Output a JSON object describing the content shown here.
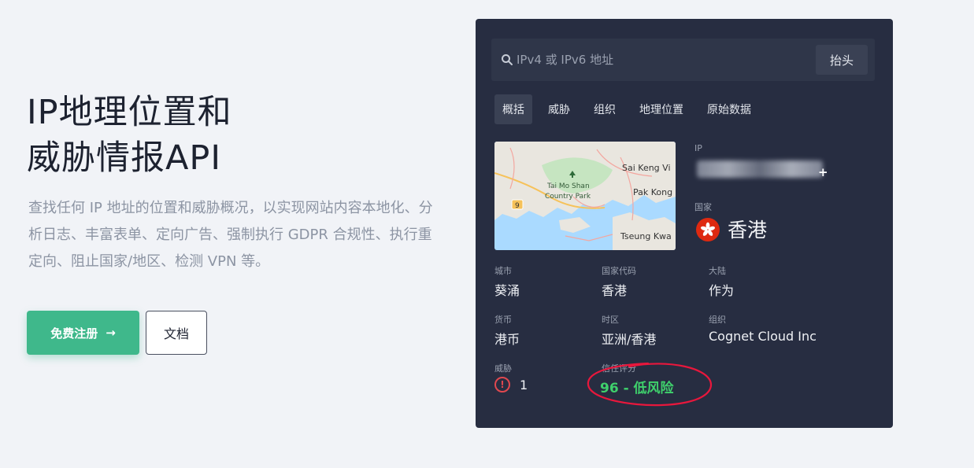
{
  "hero": {
    "title_line1": "IP地理位置和",
    "title_line2": "威胁情报API",
    "description": "查找任何 IP 地址的位置和威胁概况，以实现网站内容本地化、分析日志、丰富表单、定向广告、强制执行 GDPR 合规性、执行重定向、阻止国家/地区、检测 VPN 等。",
    "signup_label": "免费注册",
    "signup_arrow": "→",
    "docs_label": "文档"
  },
  "search": {
    "placeholder": "IPv4 或 IPv6 地址",
    "button_label": "抬头"
  },
  "tabs": [
    {
      "label": "概括",
      "active": true
    },
    {
      "label": "威胁",
      "active": false
    },
    {
      "label": "组织",
      "active": false
    },
    {
      "label": "地理位置",
      "active": false
    },
    {
      "label": "原始数据",
      "active": false
    }
  ],
  "map": {
    "labels": [
      "Sai Keng Vi",
      "Tai Mo Shan",
      "Country Park",
      "Pak Kong",
      "Tseung Kwa"
    ],
    "marker": "9"
  },
  "details": {
    "ip_label": "IP",
    "ip_plus": "+",
    "country_label": "国家",
    "country_value": "香港",
    "city_label": "城市",
    "city_value": "葵涌",
    "country_code_label": "国家代码",
    "country_code_value": "香港",
    "continent_label": "大陆",
    "continent_value": "作为",
    "currency_label": "货币",
    "currency_value": "港币",
    "timezone_label": "时区",
    "timezone_value": "亚洲/香港",
    "org_label": "组织",
    "org_value": "Cognet Cloud Inc",
    "threat_label": "威胁",
    "threat_icon": "!",
    "threat_value": "1",
    "trust_label": "信任评分",
    "trust_value": "96 - 低风险"
  },
  "colors": {
    "page_bg": "#f1f3f7",
    "panel_bg": "#272d41",
    "accent_green": "#3fb88b",
    "trust_green": "#3fd06c",
    "annotation_red": "#e8173c",
    "flag_red": "#de2910"
  }
}
